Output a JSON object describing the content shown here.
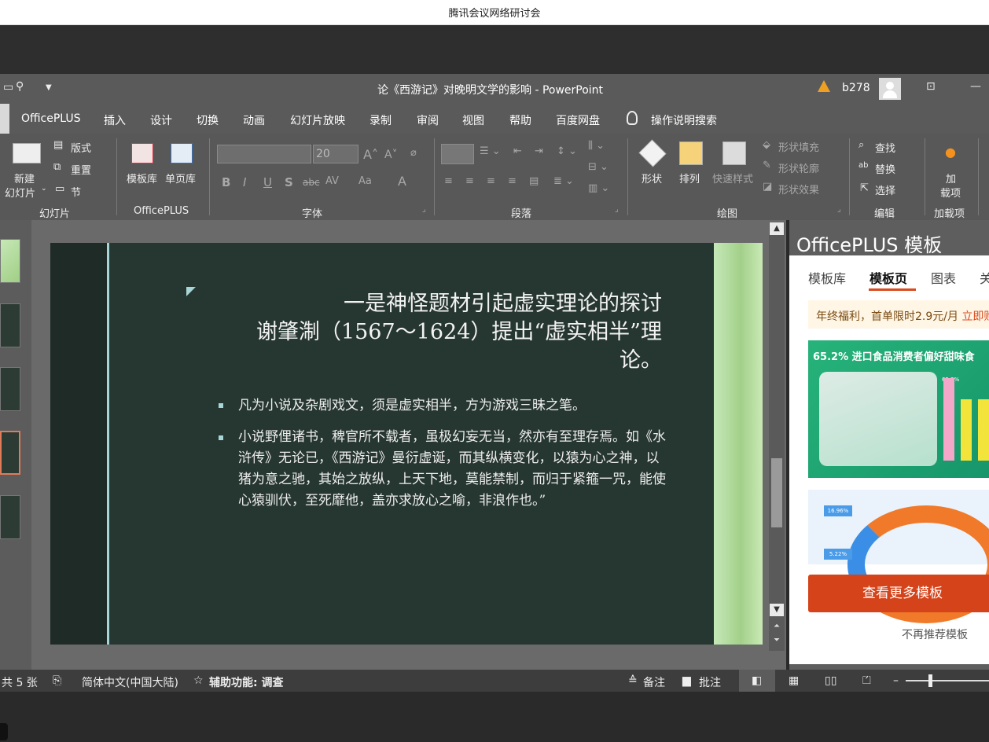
{
  "meeting": {
    "title": "腾讯会议网络研讨会"
  },
  "titlebar": {
    "doc_title": "论《西游记》对晚明文学的影响  -  PowerPoint",
    "user": "b278"
  },
  "tabs": [
    "OfficePLUS",
    "插入",
    "设计",
    "切换",
    "动画",
    "幻灯片放映",
    "录制",
    "审阅",
    "视图",
    "帮助",
    "百度网盘",
    "操作说明搜索"
  ],
  "ribbon": {
    "slides": {
      "new_slide": "新建",
      "new_slide2": "幻灯片",
      "layout": "版式",
      "reset": "重置",
      "section": "节",
      "label": "幻灯片"
    },
    "officeplus": {
      "template_lib": "模板库",
      "single_page": "单页库",
      "label": "OfficePLUS"
    },
    "font": {
      "size": "20",
      "label": "字体",
      "bold": "B",
      "italic": "I",
      "underline": "U",
      "strike": "S",
      "abc": "abc",
      "av": "AV",
      "aa": "Aa",
      "a": "A"
    },
    "paragraph": {
      "label": "段落"
    },
    "drawing": {
      "shapes": "形状",
      "arrange": "排列",
      "quick_styles": "快速样式",
      "fill": "形状填充",
      "outline": "形状轮廓",
      "effects": "形状效果",
      "label": "绘图"
    },
    "editing": {
      "find": "查找",
      "replace": "替换",
      "select": "选择",
      "label": "编辑"
    },
    "addins": {
      "add": "加",
      "add2": "载项",
      "label": "加载项"
    }
  },
  "slide": {
    "title_line1": "一是神怪题材引起虚实理论的探讨",
    "title_line2": "谢肇淛（1567～1624）提出“虚实相半”理",
    "title_line3": "论。",
    "bullet1": "凡为小说及杂剧戏文，须是虚实相半，方为游戏三昧之笔。",
    "bullet2": "小说野俚诸书，稗官所不载者，虽极幻妄无当，然亦有至理存焉。如《水浒传》无论已，《西游记》曼衍虚诞，而其纵横变化，以猿为心之神，以猪为意之驰，其始之放纵，上天下地，莫能禁制，而归于紧箍一咒，能使心猿驯伏，至死靡他，盖亦求放心之喻，非浪作也。”"
  },
  "pane": {
    "title": "OfficePLUS 模板",
    "tabs": [
      "模板库",
      "模板页",
      "图表",
      "关"
    ],
    "promo": "年终福利，首单限时2.9元/月",
    "promo_link": "立即购",
    "card1_title": "65.2% 进口食品消费者偏好甜味食",
    "card1_value": "65.2%",
    "card2_chip1": "16.96%",
    "card2_chip2": "5.22%",
    "more_button": "查看更多模板",
    "no_recommend": "不再推荐模板"
  },
  "status": {
    "slide_count": "共 5 张",
    "language": "简体中文(中国大陆)",
    "accessibility": "辅助功能: 调查",
    "notes": "备注",
    "comments": "批注",
    "zoom_percent": null
  }
}
